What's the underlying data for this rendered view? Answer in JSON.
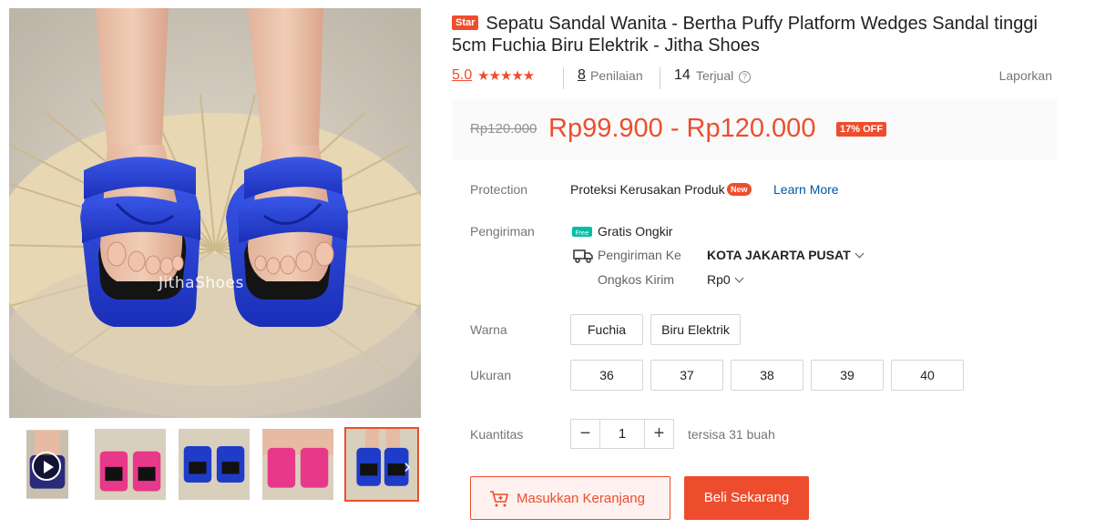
{
  "gallery": {
    "watermark": "JithaShoes",
    "thumbnails": [
      {
        "kind": "video",
        "color": "#2a2a7a"
      },
      {
        "kind": "image",
        "color": "#e8388a"
      },
      {
        "kind": "image",
        "color": "#1e3cc8"
      },
      {
        "kind": "image",
        "color": "#e8388a"
      },
      {
        "kind": "image",
        "color": "#1e3cc8",
        "active": true
      }
    ],
    "play_icon": "play-icon",
    "next_icon": "chevron-right-icon"
  },
  "product": {
    "star_badge": "Star",
    "title": "Sepatu Sandal Wanita - Bertha Puffy Platform Wedges Sandal tinggi 5cm Fuchia Biru Elektrik - Jitha Shoes"
  },
  "rating": {
    "score": "5.0",
    "stars": "★★★★★",
    "reviews_count": "8",
    "reviews_label": "Penilaian",
    "sold_count": "14",
    "sold_label": "Terjual",
    "help_icon": "?",
    "report_label": "Laporkan"
  },
  "price": {
    "original": "Rp120.000",
    "current": "Rp99.900 - Rp120.000",
    "discount": "17% OFF"
  },
  "protection": {
    "label": "Protection",
    "text": "Proteksi Kerusakan Produk",
    "new_badge": "New",
    "learn_more": "Learn More"
  },
  "shipping": {
    "label": "Pengiriman",
    "free_icon_text": "Free",
    "free_label": "Gratis Ongkir",
    "to_label": "Pengiriman Ke",
    "to_value": "KOTA JAKARTA PUSAT",
    "cost_label": "Ongkos Kirim",
    "cost_value": "Rp0"
  },
  "color": {
    "label": "Warna",
    "options": [
      "Fuchia",
      "Biru Elektrik"
    ]
  },
  "size": {
    "label": "Ukuran",
    "options": [
      "36",
      "37",
      "38",
      "39",
      "40"
    ]
  },
  "quantity": {
    "label": "Kuantitas",
    "minus": "−",
    "value": "1",
    "plus": "+",
    "stock_text": "tersisa 31 buah"
  },
  "actions": {
    "add_to_cart": "Masukkan Keranjang",
    "buy_now": "Beli Sekarang"
  },
  "colors": {
    "accent": "#ee4d2d",
    "link": "#0055aa",
    "price_box_bg": "#fafafa"
  }
}
